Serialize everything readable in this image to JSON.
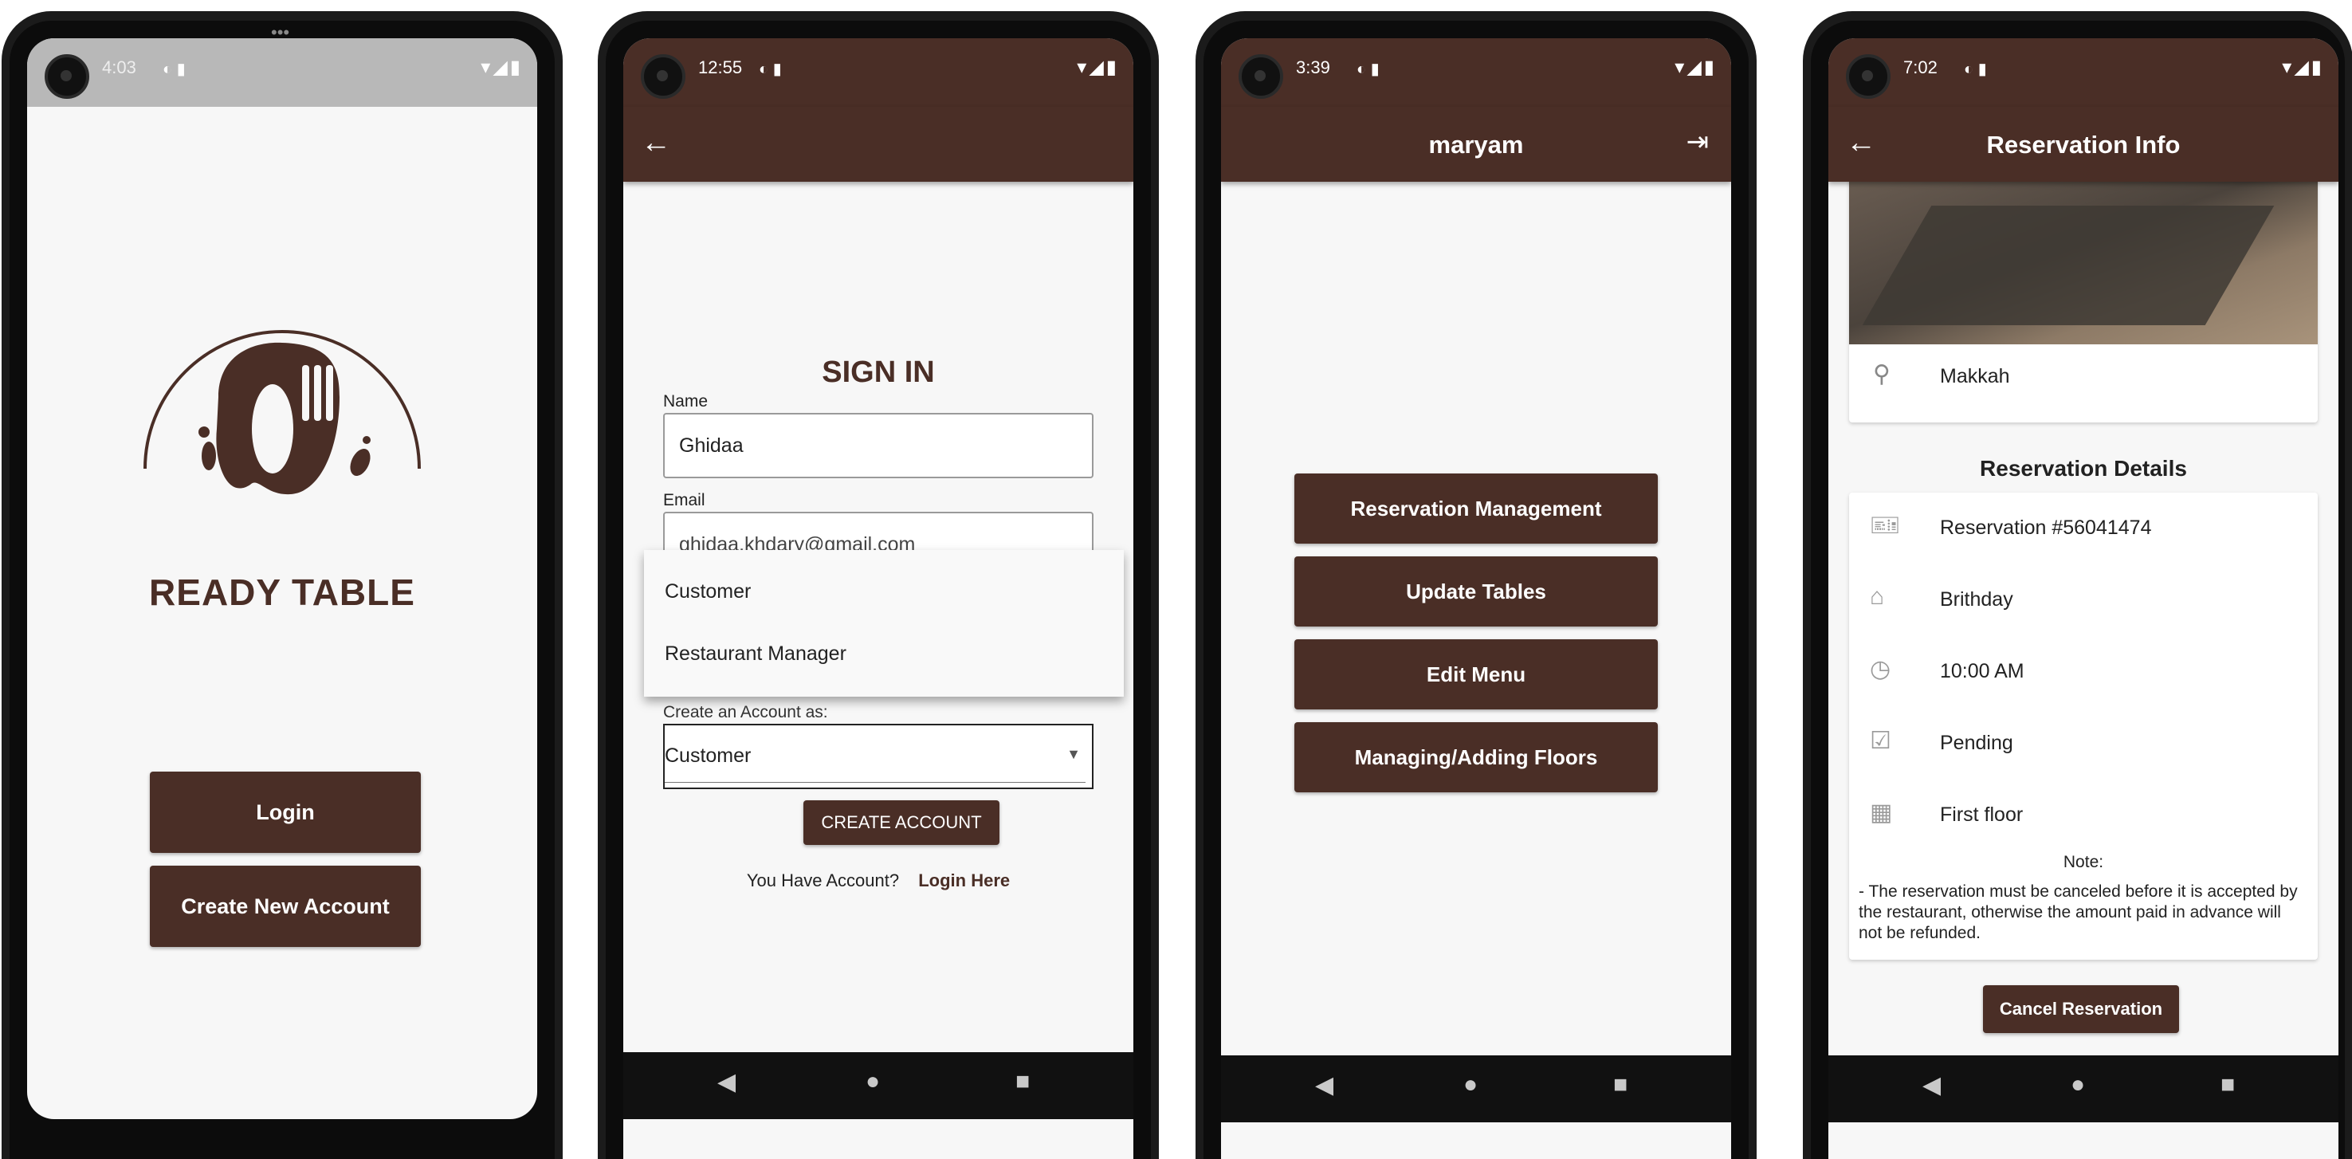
{
  "colors": {
    "brand": "#4a2e26",
    "screen_bg": "#f7f7f7"
  },
  "screen1": {
    "time": "4:03",
    "logo_text": "READY TABLE",
    "login_button": "Login",
    "create_account_button": "Create New Account"
  },
  "screen2": {
    "time": "12:55",
    "title": "SIGN IN",
    "name_label": "Name",
    "name_value": "Ghidaa",
    "email_label": "Email",
    "email_value": "ghidaa.khdary@gmail.com",
    "dropdown_options": [
      "Customer",
      "Restaurant Manager"
    ],
    "account_type_label": "Create an Account as:",
    "account_type_value": "Customer",
    "create_button": "CREATE ACCOUNT",
    "have_account_text": "You Have Account?",
    "login_link": "Login Here"
  },
  "screen3": {
    "time": "3:39",
    "title": "maryam",
    "menu": [
      "Reservation Management",
      "Update Tables",
      "Edit Menu",
      "Managing/Adding Floors"
    ]
  },
  "screen4": {
    "time": "7:02",
    "title": "Reservation Info",
    "location": "Makkah",
    "details_heading": "Reservation Details",
    "details": [
      {
        "icon": "ticket-icon",
        "text": "Reservation #56041474"
      },
      {
        "icon": "occasion-icon",
        "text": "Brithday"
      },
      {
        "icon": "clock-icon",
        "text": "10:00 AM"
      },
      {
        "icon": "calendar-check-icon",
        "text": "Pending"
      },
      {
        "icon": "building-icon",
        "text": "First floor"
      }
    ],
    "note_label": "Note:",
    "note_text": "- The reservation must be canceled before it is accepted by the restaurant, otherwise the amount paid in advance will not be refunded.",
    "cancel_button": "Cancel Reservation"
  }
}
